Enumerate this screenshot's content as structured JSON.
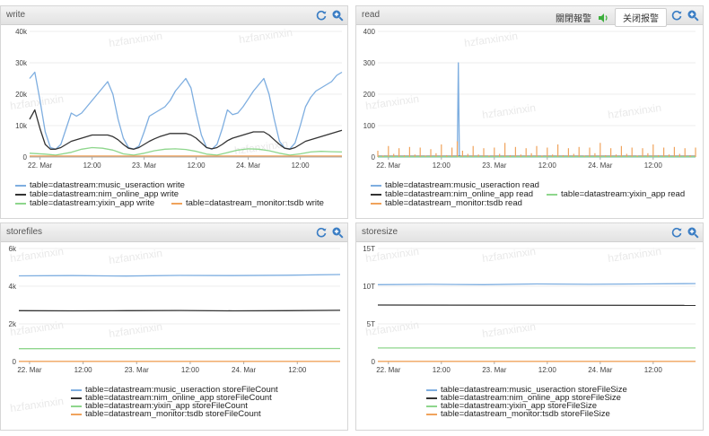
{
  "watermark": "hzfanxinxin",
  "panels": [
    {
      "title": "write",
      "chart_data": {
        "type": "line",
        "title": "write",
        "x_tick_labels": [
          "22. Mar",
          "12:00",
          "23. Mar",
          "12:00",
          "24. Mar",
          "12:00"
        ],
        "y_tick_labels": [
          "0",
          "10k",
          "20k",
          "30k",
          "40k"
        ],
        "xlim": [
          0,
          60
        ],
        "ylim": [
          0,
          40000
        ],
        "grid": true,
        "legend_position": "bottom",
        "series": [
          {
            "name": "table=datastream:music_useraction write",
            "color": "#7eaee0",
            "x": [
              0,
              1,
              2,
              3,
              4,
              5,
              6,
              7,
              8,
              9,
              10,
              11,
              12,
              13,
              14,
              15,
              16,
              17,
              18,
              19,
              20,
              21,
              22,
              23,
              24,
              25,
              26,
              27,
              28,
              29,
              30,
              31,
              32,
              33,
              34,
              35,
              36,
              37,
              38,
              39,
              40,
              41,
              42,
              43,
              44,
              45,
              46,
              47,
              48,
              49,
              50,
              51,
              52,
              53,
              54,
              55,
              56,
              57,
              58,
              59,
              60
            ],
            "y": [
              25000,
              27000,
              18000,
              8000,
              3000,
              2500,
              4000,
              9000,
              14000,
              13000,
              14000,
              16000,
              18000,
              20000,
              22000,
              24000,
              20000,
              12000,
              6000,
              3000,
              2500,
              3500,
              8000,
              13000,
              14000,
              15000,
              16000,
              18000,
              21000,
              23000,
              25000,
              22000,
              14000,
              7000,
              3000,
              2500,
              4000,
              9000,
              15000,
              13500,
              14000,
              16000,
              18500,
              21000,
              23000,
              25000,
              20000,
              12000,
              5000,
              2800,
              2600,
              4500,
              10000,
              16000,
              19000,
              21000,
              22000,
              23000,
              24000,
              26000,
              27000
            ]
          },
          {
            "name": "table=datastream:nim_online_app write",
            "color": "#333333",
            "x": [
              0,
              1,
              2,
              3,
              4,
              5,
              6,
              7,
              8,
              9,
              10,
              11,
              12,
              13,
              14,
              15,
              16,
              17,
              18,
              19,
              20,
              21,
              22,
              23,
              24,
              25,
              26,
              27,
              28,
              29,
              30,
              31,
              32,
              33,
              34,
              35,
              36,
              37,
              38,
              39,
              40,
              41,
              42,
              43,
              44,
              45,
              46,
              47,
              48,
              49,
              50,
              51,
              52,
              53,
              54,
              55,
              56,
              57,
              58,
              59,
              60
            ],
            "y": [
              12000,
              15000,
              9000,
              4000,
              2500,
              2500,
              3000,
              4000,
              5000,
              5500,
              6000,
              6500,
              7000,
              7000,
              7000,
              7000,
              6500,
              5500,
              4000,
              2800,
              2500,
              3000,
              4000,
              5000,
              5800,
              6500,
              7000,
              7500,
              7500,
              7500,
              7500,
              7000,
              6000,
              4500,
              3000,
              2600,
              3000,
              4000,
              5200,
              6000,
              6500,
              7000,
              7500,
              8000,
              8000,
              8000,
              7000,
              5500,
              4000,
              2800,
              2500,
              3000,
              4000,
              5000,
              5500,
              6000,
              6500,
              7000,
              7500,
              8000,
              8500
            ]
          },
          {
            "name": "table=datastream:yixin_app write",
            "color": "#8ed68c",
            "x": [
              0,
              3,
              5,
              8,
              10,
              12,
              14,
              16,
              18,
              20,
              22,
              24,
              26,
              28,
              30,
              32,
              34,
              36,
              38,
              40,
              42,
              44,
              46,
              48,
              50,
              52,
              54,
              56,
              58,
              60
            ],
            "y": [
              1200,
              900,
              600,
              1500,
              2500,
              3000,
              2800,
              2200,
              1000,
              600,
              1200,
              2000,
              2500,
              2600,
              2400,
              1800,
              900,
              600,
              1400,
              2200,
              2600,
              2500,
              2000,
              1200,
              600,
              1000,
              1600,
              1800,
              1700,
              1600
            ]
          },
          {
            "name": "table=datastream_monitor:tsdb write",
            "color": "#f0a35c",
            "x": [
              0,
              60
            ],
            "y": [
              300,
              300
            ]
          }
        ]
      }
    },
    {
      "title": "read",
      "alarm": {
        "label": "關閉報警",
        "button": "关闭报警"
      },
      "chart_data": {
        "type": "line",
        "title": "read",
        "x_tick_labels": [
          "22. Mar",
          "12:00",
          "23. Mar",
          "12:00",
          "24. Mar",
          "12:00"
        ],
        "y_tick_labels": [
          "0",
          "100",
          "200",
          "300",
          "400"
        ],
        "xlim": [
          0,
          60
        ],
        "ylim": [
          0,
          400
        ],
        "grid": true,
        "legend_position": "bottom",
        "series": [
          {
            "name": "table=datastream:music_useraction read",
            "color": "#7eaee0",
            "x": [
              0,
              15,
              15.2,
              15.4,
              60
            ],
            "y": [
              0,
              0,
              300,
              0,
              0
            ]
          },
          {
            "name": "table=datastream:nim_online_app read",
            "color": "#333333",
            "x": [
              0,
              60
            ],
            "y": [
              2,
              2
            ]
          },
          {
            "name": "table=datastream:yixin_app read",
            "color": "#8ed68c",
            "x": [
              0,
              60
            ],
            "y": [
              1,
              1
            ]
          },
          {
            "name": "table=datastream_monitor:tsdb read",
            "color": "#f0a35c",
            "x": [
              0,
              1,
              2,
              3,
              4,
              5,
              6,
              7,
              8,
              9,
              10,
              11,
              12,
              13,
              14,
              15,
              16,
              17,
              18,
              19,
              20,
              21,
              22,
              23,
              24,
              25,
              26,
              27,
              28,
              29,
              30,
              31,
              32,
              33,
              34,
              35,
              36,
              37,
              38,
              39,
              40,
              41,
              42,
              43,
              44,
              45,
              46,
              47,
              48,
              49,
              50,
              51,
              52,
              53,
              54,
              55,
              56,
              57,
              58,
              59,
              60
            ],
            "y": [
              20,
              5,
              35,
              10,
              28,
              6,
              32,
              8,
              30,
              5,
              25,
              12,
              40,
              6,
              30,
              50,
              20,
              10,
              35,
              8,
              28,
              5,
              30,
              10,
              45,
              6,
              32,
              8,
              28,
              12,
              35,
              5,
              30,
              8,
              40,
              6,
              28,
              10,
              32,
              5,
              30,
              12,
              45,
              6,
              28,
              8,
              35,
              10,
              30,
              5,
              28,
              12,
              40,
              6,
              30,
              8,
              32,
              10,
              28,
              6,
              30
            ]
          }
        ]
      }
    },
    {
      "title": "storefiles",
      "chart_data": {
        "type": "line",
        "title": "storefiles",
        "x_tick_labels": [
          "22. Mar",
          "12:00",
          "23. Mar",
          "12:00",
          "24. Mar",
          "12:00"
        ],
        "y_tick_labels": [
          "0",
          "2k",
          "4k",
          "6k"
        ],
        "xlim": [
          0,
          60
        ],
        "ylim": [
          0,
          6000
        ],
        "grid": true,
        "legend_position": "bottom",
        "series": [
          {
            "name": "table=datastream:music_useraction storeFileCount",
            "color": "#7eaee0",
            "x": [
              0,
              10,
              20,
              30,
              40,
              50,
              60
            ],
            "y": [
              4550,
              4560,
              4540,
              4570,
              4560,
              4580,
              4620
            ]
          },
          {
            "name": "table=datastream:nim_online_app storeFileCount",
            "color": "#333333",
            "x": [
              0,
              10,
              20,
              30,
              40,
              50,
              60
            ],
            "y": [
              2700,
              2690,
              2700,
              2710,
              2690,
              2700,
              2720
            ]
          },
          {
            "name": "table=datastream:yixin_app storeFileCount",
            "color": "#8ed68c",
            "x": [
              0,
              60
            ],
            "y": [
              680,
              690
            ]
          },
          {
            "name": "table=datastream_monitor:tsdb storeFileCount",
            "color": "#f0a35c",
            "x": [
              0,
              60
            ],
            "y": [
              10,
              10
            ]
          }
        ]
      }
    },
    {
      "title": "storesize",
      "chart_data": {
        "type": "line",
        "title": "storesize",
        "x_tick_labels": [
          "22. Mar",
          "12:00",
          "23. Mar",
          "12:00",
          "24. Mar",
          "12:00"
        ],
        "y_tick_labels": [
          "0",
          "5T",
          "10T",
          "15T"
        ],
        "xlim": [
          0,
          60
        ],
        "ylim": [
          0,
          15
        ],
        "grid": true,
        "legend_position": "bottom",
        "series": [
          {
            "name": "table=datastream:music_useraction storeFileSize",
            "color": "#7eaee0",
            "x": [
              0,
              10,
              20,
              30,
              40,
              50,
              60
            ],
            "y": [
              10.2,
              10.25,
              10.2,
              10.3,
              10.25,
              10.3,
              10.35
            ]
          },
          {
            "name": "table=datastream:nim_online_app storeFileSize",
            "color": "#333333",
            "x": [
              0,
              60
            ],
            "y": [
              7.5,
              7.45
            ]
          },
          {
            "name": "table=datastream:yixin_app storeFileSize",
            "color": "#8ed68c",
            "x": [
              0,
              60
            ],
            "y": [
              1.8,
              1.8
            ]
          },
          {
            "name": "table=datastream_monitor:tsdb storeFileSize",
            "color": "#f0a35c",
            "x": [
              0,
              60
            ],
            "y": [
              0.02,
              0.02
            ]
          }
        ]
      }
    }
  ]
}
